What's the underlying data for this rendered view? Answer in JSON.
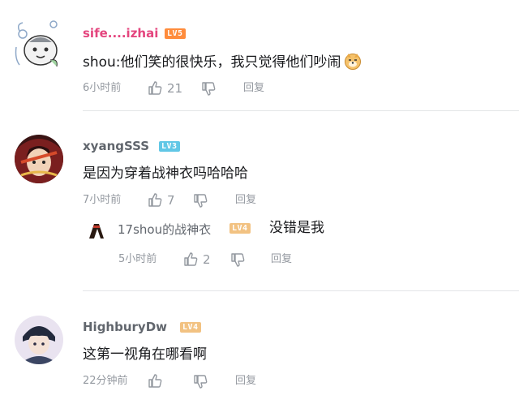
{
  "comments": [
    {
      "username": "sife....izhai",
      "username_color": "#e4457e",
      "level": "LV5",
      "text": "shou:他们笑的很快乐，我只觉得他们吵闹",
      "emoji": "doge-icon",
      "time": "6小时前",
      "likes": "21",
      "reply_label": "回复"
    },
    {
      "username": "xyangSSS",
      "username_color": "#61666d",
      "level": "LV3",
      "text": "是因为穿着战神衣吗哈哈哈",
      "time": "7小时前",
      "likes": "7",
      "reply_label": "回复",
      "replies": [
        {
          "username": "17shou的战神衣",
          "level": "LV4",
          "text": "没错是我",
          "time": "5小时前",
          "likes": "2",
          "reply_label": "回复"
        }
      ]
    },
    {
      "username": "HighburyDw",
      "username_color": "#61666d",
      "level": "LV4",
      "text": "这第一视角在哪看啊",
      "time": "22分钟前",
      "reply_label": "回复"
    }
  ],
  "colors": {
    "meta_text": "#9499a0",
    "divider": "#e3e5e7",
    "lv3": "#61c7e6",
    "lv4": "#f2c282",
    "lv5": "#ff8c3c"
  }
}
